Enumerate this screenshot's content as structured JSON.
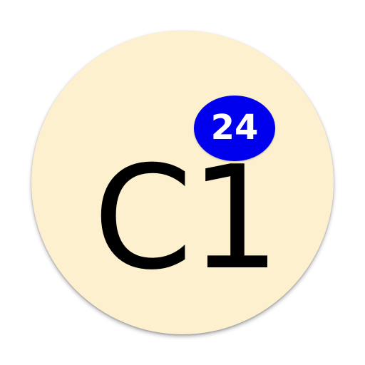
{
  "icon": {
    "label": "C1",
    "background_color": "#fdf0cf",
    "text_color": "#000000"
  },
  "badge": {
    "count": "24",
    "background_color": "#0000ee",
    "text_color": "#ffffff"
  }
}
